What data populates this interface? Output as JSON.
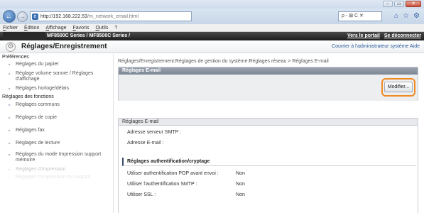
{
  "browser": {
    "address": "http://192.168.222.53/m_network_email.html",
    "address_host": "http://192.168.222.53",
    "address_path": "/m_network_email.html",
    "search_controls": "ρ - ⊠ C ✕",
    "menu": [
      "Fichier",
      "Édition",
      "Affichage",
      "Favoris",
      "Outils",
      "?"
    ],
    "window_controls": [
      "–",
      "▭",
      "✕"
    ]
  },
  "device": {
    "name": "MF8500C Series / MF8500C Series /",
    "link_portal": "Vers le portail",
    "link_logout": "Se déconnecter"
  },
  "header": {
    "title": "Réglages/Enregistrement",
    "right_text": "Courrier à l'administrateur système  Aide"
  },
  "sidebar": {
    "sections": [
      {
        "title": "Préférences",
        "items": [
          "Réglages du papier",
          "Réglage volume sonore / Réglages d'affichage",
          "Réglages horloge/délais"
        ]
      },
      {
        "title": "Réglages des fonctions",
        "items": [
          "Réglages communs",
          "Réglages de copie",
          "Réglages fax",
          "Réglages de lecture",
          "Réglages du mode Impression support mémoire",
          "Réglages d'impression",
          "Réglages d'impression du support"
        ]
      }
    ]
  },
  "main": {
    "breadcrumb": "Réglages/Enregistrement:Réglages de gestion du système:Réglages réseau > Réglages E-mail",
    "panel_title": "Réglages E-mail",
    "modify_button": "Modifier...",
    "section_title": "Réglages E-mail",
    "smtp_server_label": "Adresse serveur SMTP :",
    "email_label": "Adresse E-mail :",
    "auth_section": "Réglages authentification/cryptage",
    "rows": [
      {
        "label": "Utiliser authentification POP avant envoi :",
        "value": "Non"
      },
      {
        "label": "Utiliser l'authentification SMTP :",
        "value": "Non"
      },
      {
        "label": "Utiliser SSL :",
        "value": "Non"
      }
    ]
  }
}
